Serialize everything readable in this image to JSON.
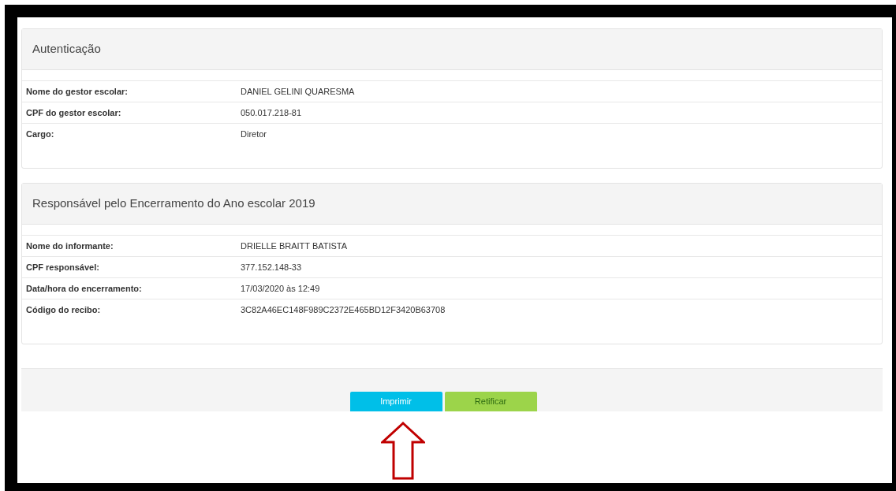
{
  "panels": [
    {
      "title": "Autenticação",
      "rows": [
        {
          "label": "Nome do gestor escolar:",
          "value": "DANIEL GELINI QUARESMA"
        },
        {
          "label": "CPF do gestor escolar:",
          "value": "050.017.218-81"
        },
        {
          "label": "Cargo:",
          "value": "Diretor"
        }
      ]
    },
    {
      "title": "Responsável pelo Encerramento do Ano escolar 2019",
      "rows": [
        {
          "label": "Nome do informante:",
          "value": "DRIELLE BRAITT BATISTA"
        },
        {
          "label": "CPF responsável:",
          "value": "377.152.148-33"
        },
        {
          "label": "Data/hora do encerramento:",
          "value": "17/03/2020 às 12:49"
        },
        {
          "label": "Código do recibo:",
          "value": "3C82A46EC148F989C2372E465BD12F3420B63708"
        }
      ]
    }
  ],
  "buttons": [
    {
      "label": "Imprimir",
      "kind": "info"
    },
    {
      "label": "Retificar",
      "kind": "success"
    }
  ]
}
